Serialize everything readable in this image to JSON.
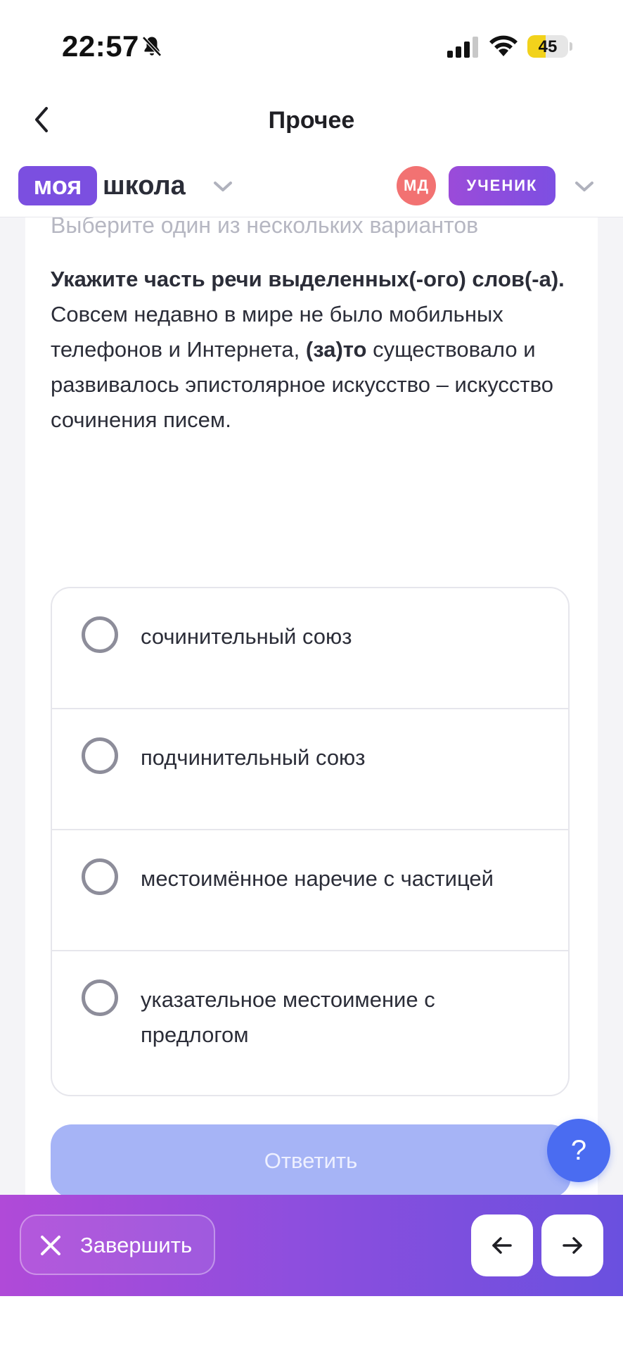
{
  "status_bar": {
    "time": "22:57",
    "battery_level": "45",
    "icons": [
      "bell-muted-icon",
      "cellular-signal-icon",
      "wifi-icon",
      "battery-icon"
    ]
  },
  "nav": {
    "title": "Прочее",
    "back_icon": "chevron-left-icon"
  },
  "app_header": {
    "logo_part1": "моя",
    "logo_part2": "школа",
    "avatar_initials": "МД",
    "role": "УЧЕНИК",
    "accent_color": "#7b4fe0",
    "avatar_color": "#f27272"
  },
  "question": {
    "hint": "Выберите один из нескольких вариантов",
    "title": "Укажите часть речи выделенных(-ого) слов(-а).",
    "text_before": "Совсем недавно в мире не было мобильных телефонов и Интернета, ",
    "highlight": "(за)то",
    "text_after": " существовало и развивалось эпистолярное искусство – искусство сочинения писем."
  },
  "options": [
    {
      "label": "сочинительный союз"
    },
    {
      "label": "подчинительный союз"
    },
    {
      "label": "местоимённое наречие с частицей"
    },
    {
      "label": "указательное местоимение с предлогом"
    }
  ],
  "actions": {
    "submit_label": "Ответить",
    "help_label": "?",
    "finish_label": "Завершить",
    "submit_color": "#a6b4f6",
    "help_color": "#4a6cf1"
  }
}
